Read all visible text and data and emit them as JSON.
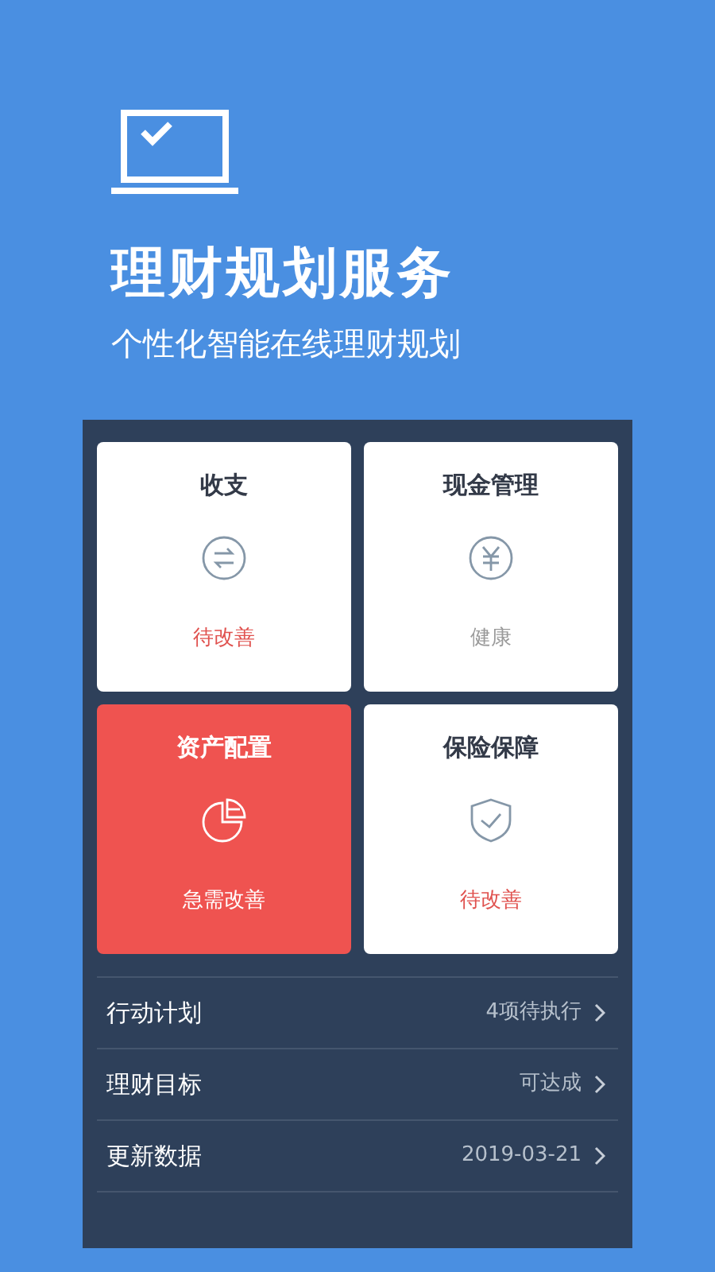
{
  "header": {
    "title": "理财规划服务",
    "subtitle": "个性化智能在线理财规划"
  },
  "cards": [
    {
      "title": "收支",
      "kind": "exchange",
      "highlighted": false,
      "status_text": "待改善",
      "color": "#e0524f"
    },
    {
      "title": "现金管理",
      "kind": "yuan",
      "highlighted": false,
      "status_text": "健康",
      "color": "#9a9a9a"
    },
    {
      "title": "资产配置",
      "kind": "pie",
      "highlighted": true,
      "status_text": "急需改善",
      "color": "#ffffff"
    },
    {
      "title": "保险保障",
      "kind": "shield",
      "highlighted": false,
      "status_text": "待改善",
      "color": "#e0524f"
    }
  ],
  "rows": [
    {
      "label": "行动计划",
      "value": "4项待执行"
    },
    {
      "label": "理财目标",
      "value": "可达成"
    },
    {
      "label": "更新数据",
      "value": "2019-03-21"
    }
  ]
}
